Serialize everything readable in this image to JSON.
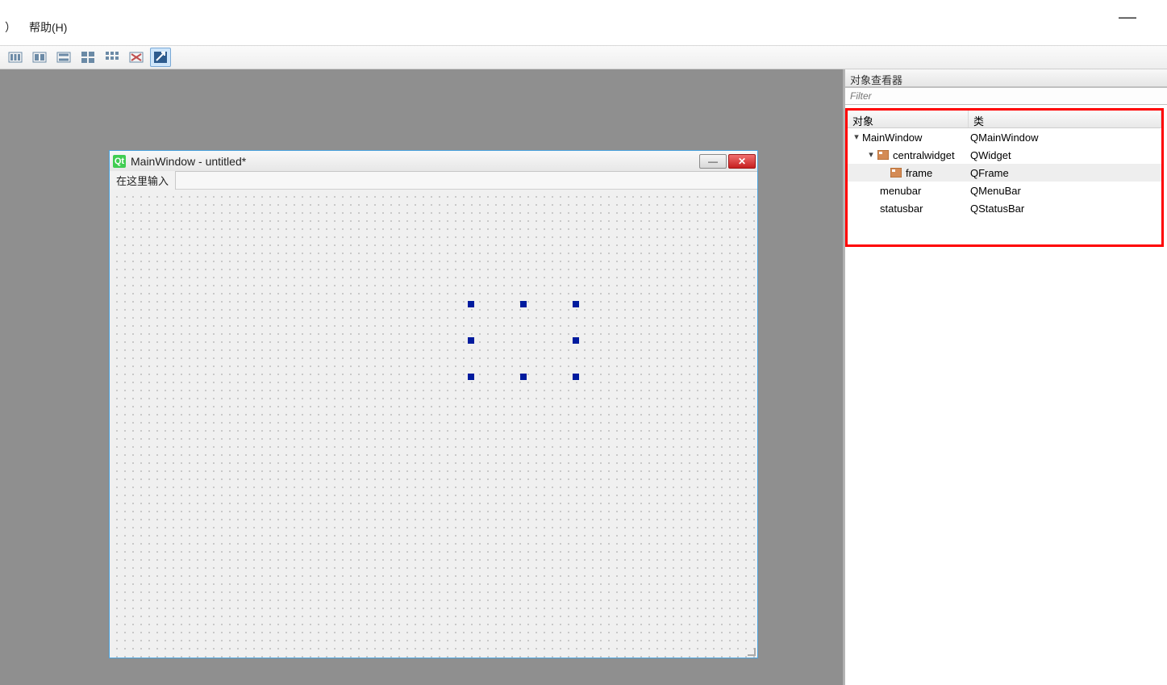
{
  "menubar": {
    "items": [
      "）",
      "帮助(H)"
    ]
  },
  "toolbar_icons": [
    "layout-h-icon",
    "layout-v-icon",
    "layout-form-icon",
    "layout-grid-icon",
    "layout-grid2-icon",
    "break-layout-icon",
    "adjust-size-icon"
  ],
  "mock_window": {
    "title": "MainWindow - untitled*",
    "menu_hint": "在这里输入",
    "qt_badge": "Qt"
  },
  "right_panel": {
    "title": "对象查看器",
    "filter_placeholder": "Filter",
    "headers": {
      "object": "对象",
      "class": "类"
    },
    "tree": [
      {
        "depth": 1,
        "expanded": true,
        "icon": "",
        "object": "MainWindow",
        "class": "QMainWindow",
        "selected": false
      },
      {
        "depth": 2,
        "expanded": true,
        "icon": "widget",
        "object": "centralwidget",
        "class": "QWidget",
        "selected": false
      },
      {
        "depth": 3,
        "expanded": false,
        "icon": "widget",
        "object": "frame",
        "class": "QFrame",
        "selected": true
      },
      {
        "depth": 2,
        "expanded": false,
        "icon": "",
        "object": "menubar",
        "class": "QMenuBar",
        "selected": false,
        "noexp": true
      },
      {
        "depth": 2,
        "expanded": false,
        "icon": "",
        "object": "statusbar",
        "class": "QStatusBar",
        "selected": false,
        "noexp": true
      }
    ]
  },
  "top_right_dash": "—"
}
